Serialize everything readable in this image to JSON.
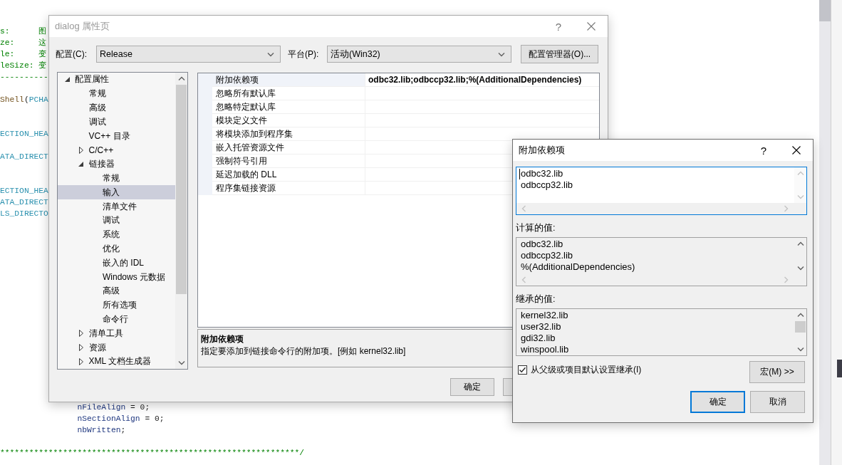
{
  "editor": {
    "code_blocks": [
      {
        "lines": [
          {
            "kind": "code",
            "tokens": [
              {
                "text": "s:      图",
                "kind": "comment"
              }
            ]
          },
          {
            "kind": "code",
            "tokens": [
              {
                "text": "ze:     这",
                "kind": "comment"
              }
            ]
          },
          {
            "kind": "code",
            "tokens": [
              {
                "text": "le:     变",
                "kind": "comment"
              }
            ]
          },
          {
            "kind": "code",
            "tokens": [
              {
                "text": "leSize: 变",
                "kind": "comment"
              }
            ]
          },
          {
            "kind": "code",
            "tokens": [
              {
                "text": "----------",
                "kind": "comment"
              }
            ]
          },
          {
            "kind": "blank"
          },
          {
            "kind": "code",
            "tokens": [
              {
                "text": "Shell",
                "kind": "function"
              },
              {
                "text": "(",
                "kind": "plain"
              },
              {
                "text": "PCHA",
                "kind": "type"
              }
            ]
          },
          {
            "kind": "blank"
          },
          {
            "kind": "blank"
          },
          {
            "kind": "code",
            "tokens": [
              {
                "text": "ECTION_HEA",
                "kind": "type"
              }
            ]
          },
          {
            "kind": "blank"
          },
          {
            "kind": "code",
            "tokens": [
              {
                "text": "ATA_DIRECT",
                "kind": "type"
              }
            ]
          },
          {
            "kind": "blank"
          },
          {
            "kind": "blank"
          },
          {
            "kind": "code",
            "tokens": [
              {
                "text": "ECTION_HEA",
                "kind": "type"
              }
            ]
          },
          {
            "kind": "code",
            "tokens": [
              {
                "text": "ATA_DIRECT",
                "kind": "type"
              }
            ]
          },
          {
            "kind": "code",
            "tokens": [
              {
                "text": "LS_DIRECTO",
                "kind": "type"
              }
            ]
          }
        ]
      },
      {
        "lines": [
          {
            "kind": "code",
            "tokens": [
              {
                "text": "                nFileAlign",
                "kind": "variable"
              },
              {
                "text": " = 0;",
                "kind": "plain"
              }
            ]
          },
          {
            "kind": "code",
            "tokens": [
              {
                "text": "                nSectionAlign",
                "kind": "variable"
              },
              {
                "text": " = 0;",
                "kind": "plain"
              }
            ]
          },
          {
            "kind": "code",
            "tokens": [
              {
                "text": "                nbWritten",
                "kind": "variable"
              },
              {
                "text": ";",
                "kind": "plain"
              }
            ]
          },
          {
            "kind": "blank"
          },
          {
            "kind": "code",
            "tokens": [
              {
                "text": "**************************************************************/",
                "kind": "comment"
              }
            ]
          }
        ]
      }
    ]
  },
  "property_dialog": {
    "title": "dialog 属性页",
    "active": false,
    "help": "?",
    "config": {
      "label": "配置(C):",
      "value": "Release"
    },
    "platform": {
      "label": "平台(P):",
      "value": "活动(Win32)"
    },
    "config_manager_button": "配置管理器(O)...",
    "tree": {
      "items": [
        {
          "label": "配置属性",
          "expanded": true,
          "selected": false,
          "children": [
            {
              "label": "常规",
              "selected": false
            },
            {
              "label": "高级",
              "selected": false
            },
            {
              "label": "调试",
              "selected": false
            },
            {
              "label": "VC++ 目录",
              "selected": false
            },
            {
              "label": "C/C++",
              "expanded": false,
              "selected": false
            },
            {
              "label": "链接器",
              "expanded": true,
              "selected": false,
              "children": [
                {
                  "label": "常规",
                  "selected": false
                },
                {
                  "label": "输入",
                  "selected": true
                },
                {
                  "label": "清单文件",
                  "selected": false
                },
                {
                  "label": "调试",
                  "selected": false
                },
                {
                  "label": "系统",
                  "selected": false
                },
                {
                  "label": "优化",
                  "selected": false
                },
                {
                  "label": "嵌入的 IDL",
                  "selected": false
                },
                {
                  "label": "Windows 元数据",
                  "selected": false
                },
                {
                  "label": "高级",
                  "selected": false
                },
                {
                  "label": "所有选项",
                  "selected": false
                },
                {
                  "label": "命令行",
                  "selected": false
                }
              ]
            },
            {
              "label": "清单工具",
              "expanded": false,
              "selected": false
            },
            {
              "label": "资源",
              "expanded": false,
              "selected": false
            },
            {
              "label": "XML 文档生成器",
              "expanded": false,
              "selected": false
            }
          ]
        }
      ]
    },
    "properties": [
      {
        "name": "附加依赖项",
        "value": "odbc32.lib;odbccp32.lib;%(AdditionalDependencies)",
        "selected": true
      },
      {
        "name": "忽略所有默认库",
        "selected": false
      },
      {
        "name": "忽略特定默认库",
        "selected": false
      },
      {
        "name": "模块定义文件",
        "selected": false
      },
      {
        "name": "将模块添加到程序集",
        "selected": false
      },
      {
        "name": "嵌入托管资源文件",
        "selected": false
      },
      {
        "name": "强制符号引用",
        "selected": false
      },
      {
        "name": "延迟加载的 DLL",
        "selected": false
      },
      {
        "name": "程序集链接资源",
        "selected": false
      }
    ],
    "description": {
      "title": "附加依赖项",
      "text": "指定要添加到链接命令行的附加项。[例如 kernel32.lib]"
    },
    "buttons": [
      {
        "label": "确定"
      }
    ]
  },
  "dependencies_dialog": {
    "title": "附加依赖项",
    "active": true,
    "help": "?",
    "edit_box": {
      "lines": [
        "odbc32.lib",
        "odbccp32.lib"
      ],
      "focused": true
    },
    "computed_label": "计算的值:",
    "computed_lines": [
      "odbc32.lib",
      "odbccp32.lib",
      "%(AdditionalDependencies)"
    ],
    "inherited_label": "继承的值:",
    "inherited_lines": [
      "kernel32.lib",
      "user32.lib",
      "gdi32.lib",
      "winspool.lib"
    ],
    "inherit_checkbox": {
      "label": "从父级或项目默认设置继承(I)",
      "checked": true
    },
    "macros_button": "宏(M) >>",
    "buttons": [
      {
        "label": "确定",
        "default": true
      },
      {
        "label": "取消",
        "default": false
      }
    ]
  }
}
